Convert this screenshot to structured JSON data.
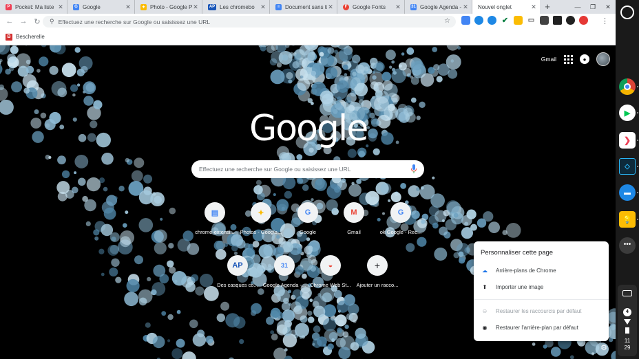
{
  "tabs": [
    {
      "title": "Pocket: Ma liste",
      "fav_color": "#ef4056",
      "fav_glyph": "P"
    },
    {
      "title": "Google",
      "fav_color": "#4285f4",
      "fav_glyph": "G"
    },
    {
      "title": "Photo - Google Ph",
      "fav_color": "#fbbc04",
      "fav_glyph": "✦"
    },
    {
      "title": "Les chromebo",
      "fav_color": "#1a56b8",
      "fav_glyph": "AP"
    },
    {
      "title": "Document sans ti",
      "fav_color": "#4285f4",
      "fav_glyph": "≡"
    },
    {
      "title": "Google Fonts",
      "fav_color": "#ea4335",
      "fav_glyph": "F"
    },
    {
      "title": "Google Agenda - ",
      "fav_color": "#4285f4",
      "fav_glyph": "31"
    },
    {
      "title": "Nouvel onglet",
      "active": true
    }
  ],
  "toolbar": {
    "omnibox_placeholder": "Effectuez une recherche sur Google ou saisissez une URL"
  },
  "bookmarks": [
    {
      "label": "Bescherelle",
      "icon": "B"
    }
  ],
  "ntp": {
    "gmail": "Gmail",
    "logo": "Google",
    "search_placeholder": "Effectuez une recherche sur Google ou saisissez une URL",
    "tiles_row1": [
      {
        "label": "chrome-extensi...",
        "glyph": "▤",
        "color": "#4285f4"
      },
      {
        "label": "Photos - Google...",
        "glyph": "✦",
        "color": "#fbbc04"
      },
      {
        "label": "Google",
        "glyph": "G",
        "color": "#4285f4"
      },
      {
        "label": "Gmail",
        "glyph": "M",
        "color": "#ea4335"
      },
      {
        "label": "ok Google - Rec...",
        "glyph": "G",
        "color": "#4285f4"
      }
    ],
    "tiles_row2": [
      {
        "label": "Des casques co...",
        "glyph": "AP",
        "color": "#1a56b8"
      },
      {
        "label": "Google Agenda -...",
        "glyph": "31",
        "color": "#4285f4"
      },
      {
        "label": "Chrome Web St...",
        "glyph": "◒",
        "color": "#ea4335"
      },
      {
        "label": "Ajouter un racco...",
        "glyph": "+",
        "color": "#202124"
      }
    ]
  },
  "customize": {
    "title": "Personnaliser cette page",
    "backgrounds": "Arrière-plans de Chrome",
    "upload": "Importer une image",
    "restore_shortcuts": "Restaurer les raccourcis par défaut",
    "restore_background": "Restaurer l'arrière-plan par défaut"
  },
  "shelf": {
    "notification_count": "4",
    "clock_hour": "11",
    "clock_minute": "29"
  }
}
